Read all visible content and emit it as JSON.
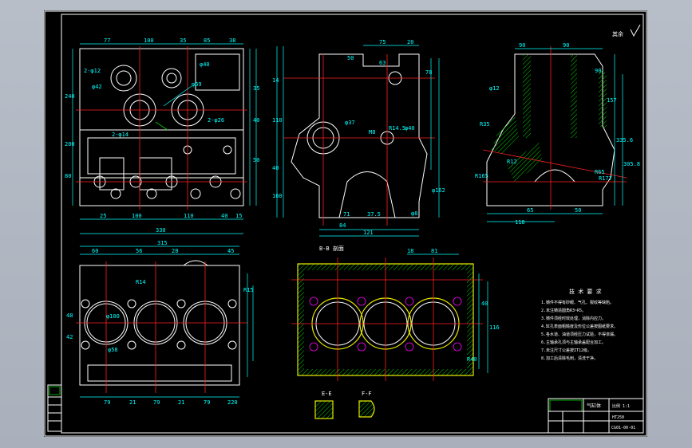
{
  "roughness_mark": "其余",
  "view_fl": {
    "dims_top": [
      "77",
      "100",
      "35",
      "85",
      "38"
    ],
    "dims_bottom": [
      "25",
      "100",
      "110",
      "40",
      "15"
    ],
    "overall": "330",
    "left_dims": [
      "80",
      "200",
      "240"
    ],
    "right_dims": [
      "35",
      "40",
      "50"
    ],
    "callouts": [
      "2-φ26",
      "φ69",
      "2-φ14",
      "2-φ12",
      "φ42",
      "φ40"
    ]
  },
  "view_fr": {
    "dims_top": [
      "75",
      "20",
      "50",
      "63",
      "78"
    ],
    "dims_bottom": [
      "71",
      "37.5",
      "84",
      "121"
    ],
    "callouts": [
      "M8",
      "R14.5",
      "φ40",
      "φ37",
      "φ162",
      "φ8"
    ],
    "left_dims": [
      "14",
      "110",
      "40",
      "160"
    ]
  },
  "view_tr": {
    "dims_top": [
      "90",
      "90"
    ],
    "dims_side": [
      "157",
      "335.6",
      "305.8"
    ],
    "dims_bottom": [
      "65",
      "50",
      "118"
    ],
    "callouts": [
      "φ12",
      "R35",
      "R12",
      "R165",
      "R65",
      "R177",
      "90"
    ]
  },
  "view_bl": {
    "dims_top": [
      "315",
      "60",
      "56",
      "28",
      "45"
    ],
    "dims_bottom": [
      "79",
      "21",
      "79",
      "21",
      "79",
      "220"
    ],
    "callouts": [
      "φ100",
      "R14",
      "φ58",
      "R15",
      "48",
      "42"
    ]
  },
  "section_view": {
    "label": "B-B 剖面",
    "dims_top": [
      "18",
      "81"
    ],
    "dims_right": [
      "40",
      "116",
      "R40"
    ],
    "detail_a": "E-E",
    "detail_b": "F-F"
  },
  "notes": {
    "heading": "技 术 要 求",
    "lines": [
      "1.铸件不得有砂眼、气孔、裂纹等缺陷。",
      "2.未注铸造圆角R3~R5。",
      "3.铸件须经时效处理，消除内应力。",
      "4.缸孔表面粗糙度及形位公差按图纸要求。",
      "5.各水道、油道须经压力试验，不得渗漏。",
      "6.主轴承孔须与主轴承盖配合加工。",
      "7.未注尺寸公差按IT12级。",
      "8.加工后清除毛刺，清洗干净。"
    ]
  },
  "title_block": {
    "name": "气缸体",
    "scale": "比例 1:1",
    "drawing_no": "CG01-00-01",
    "material": "HT250"
  },
  "colors": {
    "background": "#000000",
    "frame": "#ffffff",
    "dimension": "#00ffff",
    "centerline": "#ff2020",
    "hatch": "#00d000",
    "section_outline": "#e8e800",
    "outer_bg": "#b0b6c0"
  }
}
